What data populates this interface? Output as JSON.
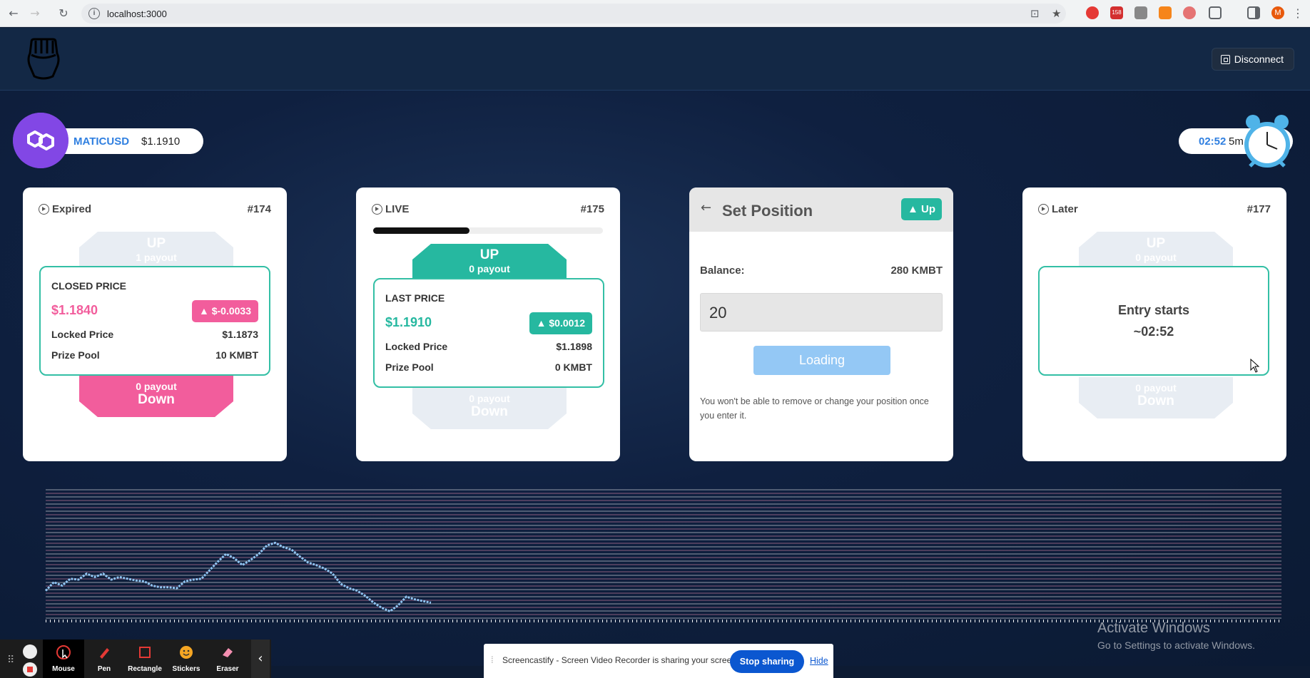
{
  "browser": {
    "url": "localhost:3000",
    "profile_initial": "M",
    "badge_count": "158"
  },
  "header": {
    "disconnect_label": "Disconnect"
  },
  "ticker": {
    "symbol": "MATICUSD",
    "price": "$1.1910"
  },
  "timer": {
    "time": "02:52",
    "interval": "5m"
  },
  "cards": {
    "expired": {
      "status": "Expired",
      "round": "#174",
      "up_label": "UP",
      "up_payout": "1 payout",
      "box_label": "CLOSED PRICE",
      "price": "$1.1840",
      "change": "$-0.0033",
      "locked_label": "Locked Price",
      "locked_value": "$1.1873",
      "pool_label": "Prize Pool",
      "pool_value": "10 KMBT",
      "down_payout": "0 payout",
      "down_label": "Down"
    },
    "live": {
      "status": "LIVE",
      "round": "#175",
      "progress": 0.42,
      "up_label": "UP",
      "up_payout": "0 payout",
      "box_label": "LAST PRICE",
      "price": "$1.1910",
      "change": "$0.0012",
      "locked_label": "Locked Price",
      "locked_value": "$1.1898",
      "pool_label": "Prize Pool",
      "pool_value": "0 KMBT",
      "down_payout": "0 payout",
      "down_label": "Down"
    },
    "set_position": {
      "title": "Set Position",
      "direction_label": "Up",
      "balance_label": "Balance:",
      "balance_value": "280 KMBT",
      "amount_value": "20",
      "button_label": "Loading",
      "note": "You won't be able to remove or change your position once you enter it."
    },
    "later": {
      "status": "Later",
      "round": "#177",
      "up_label": "UP",
      "up_payout": "0 payout",
      "entry_line1": "Entry starts",
      "entry_line2": "~02:52",
      "down_payout": "0 payout",
      "down_label": "Down"
    }
  },
  "chart_data": {
    "type": "line",
    "series": [
      {
        "values": [
          1.1842,
          1.1852,
          1.1848,
          1.1856,
          1.1855,
          1.1862,
          1.1858,
          1.1862,
          1.1855,
          1.1858,
          1.1856,
          1.1854,
          1.1853,
          1.1848,
          1.1846,
          1.1846,
          1.1845,
          1.1853,
          1.1855,
          1.1856,
          1.1866,
          1.1876,
          1.1885,
          1.188,
          1.1872,
          1.1878,
          1.1885,
          1.1895,
          1.1898,
          1.1893,
          1.189,
          1.1882,
          1.1875,
          1.1872,
          1.1868,
          1.1862,
          1.185,
          1.1845,
          1.1842,
          1.1836,
          1.1828,
          1.1822,
          1.1818,
          1.1825,
          1.1835,
          1.1832,
          1.183,
          1.1828
        ]
      }
    ],
    "ylim": [
      1.181,
      1.196
    ],
    "grid": true
  },
  "recorder": {
    "tools": [
      "Mouse",
      "Pen",
      "Rectangle",
      "Stickers",
      "Eraser"
    ],
    "share_message": "Screencastify - Screen Video Recorder is sharing your screen.",
    "stop_label": "Stop sharing",
    "hide_label": "Hide"
  },
  "watermark": {
    "line1": "Activate Windows",
    "line2": "Go to Settings to activate Windows."
  },
  "colors": {
    "accent_green": "#26b8a0",
    "accent_pink": "#f25d9c",
    "link_blue": "#2f7fe0"
  }
}
